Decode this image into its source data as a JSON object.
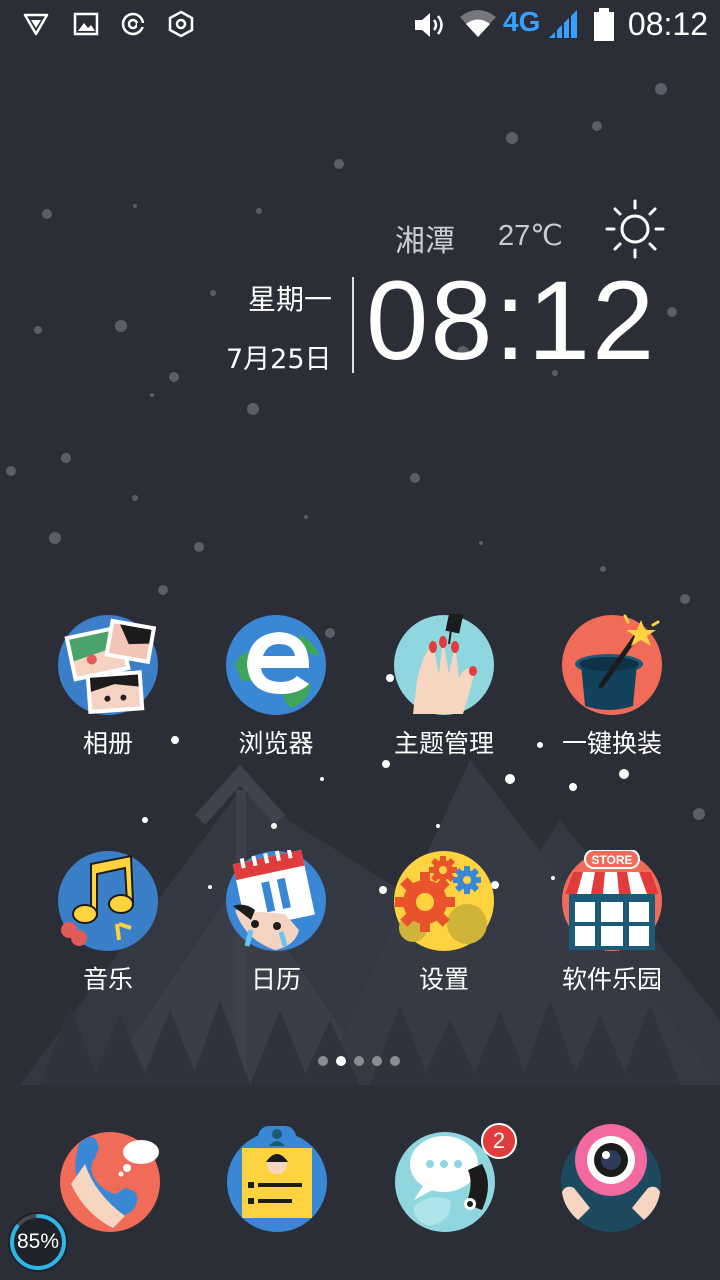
{
  "status_bar": {
    "left_icons": [
      "shield-icon",
      "gallery-icon",
      "at-icon",
      "hexagon-icon"
    ],
    "right_icons": [
      "volume-icon",
      "wifi-icon",
      "signal-icon",
      "battery-icon"
    ],
    "network": "4G",
    "time": "08:12"
  },
  "widget": {
    "city": "湘潭",
    "temperature": "27℃",
    "weather_icon": "sun-icon",
    "weekday": "星期一",
    "date": "7月25日",
    "clock": "08:12"
  },
  "apps": [
    {
      "label": "相册",
      "icon": "photo-album-icon"
    },
    {
      "label": "浏览器",
      "icon": "browser-icon"
    },
    {
      "label": "主题管理",
      "icon": "theme-manager-icon"
    },
    {
      "label": "一键换装",
      "icon": "magic-hat-icon"
    },
    {
      "label": "音乐",
      "icon": "music-note-icon"
    },
    {
      "label": "日历",
      "icon": "calendar-icon"
    },
    {
      "label": "设置",
      "icon": "settings-gear-icon"
    },
    {
      "label": "软件乐园",
      "icon": "app-store-icon"
    }
  ],
  "page_indicator": {
    "count": 5,
    "active_index": 1
  },
  "dock": [
    {
      "name": "phone",
      "icon": "phone-icon"
    },
    {
      "name": "contacts",
      "icon": "contacts-card-icon"
    },
    {
      "name": "messages",
      "icon": "messages-bubble-icon",
      "badge": "2"
    },
    {
      "name": "camera",
      "icon": "camera-icon"
    }
  ],
  "memory_boost": {
    "value": "85%",
    "fraction": 0.85
  }
}
